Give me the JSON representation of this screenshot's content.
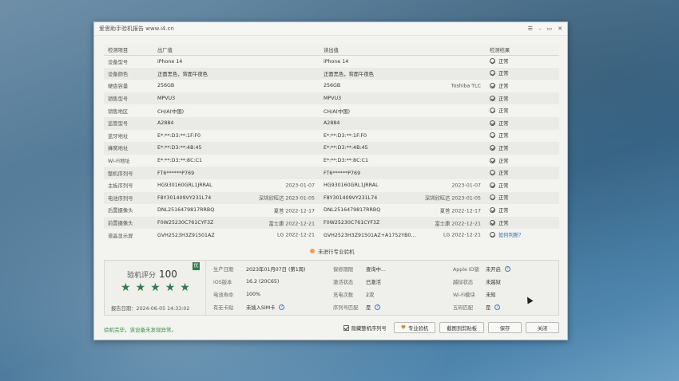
{
  "window": {
    "title": "爱思助手验机报告 www.i4.cn",
    "controls": [
      "☰",
      "–",
      "▭",
      "✕"
    ]
  },
  "table": {
    "headers": [
      "检测项目",
      "出厂值",
      "读出值",
      "检测结果"
    ],
    "rows": [
      {
        "item": "设备型号",
        "factory": "iPhone 14",
        "factory_right": "",
        "read": "iPhone 14",
        "read_right": "",
        "result": "正常",
        "link": false
      },
      {
        "item": "设备颜色",
        "factory": "正面黑色，背面午夜色",
        "factory_right": "",
        "read": "正面黑色，背面午夜色",
        "read_right": "",
        "result": "正常",
        "link": false
      },
      {
        "item": "硬盘容量",
        "factory": "256GB",
        "factory_right": "",
        "read": "256GB",
        "read_right": "Toshiba TLC",
        "result": "正常",
        "link": false
      },
      {
        "item": "销售型号",
        "factory": "MPVU3",
        "factory_right": "",
        "read": "MPVU3",
        "read_right": "",
        "result": "正常",
        "link": false
      },
      {
        "item": "销售地区",
        "factory": "CH/A(中国)",
        "factory_right": "",
        "read": "CH/A(中国)",
        "read_right": "",
        "result": "正常",
        "link": false
      },
      {
        "item": "监管型号",
        "factory": "A2884",
        "factory_right": "",
        "read": "A2884",
        "read_right": "",
        "result": "正常",
        "link": false
      },
      {
        "item": "蓝牙地址",
        "factory": "E*:**:D3:**:1F:F0",
        "factory_right": "",
        "read": "E*:**:D3:**:1F:F0",
        "read_right": "",
        "result": "正常",
        "link": false
      },
      {
        "item": "蜂窝地址",
        "factory": "E*:**:D3:**:4B:45",
        "factory_right": "",
        "read": "E*:**:D3:**:4B:45",
        "read_right": "",
        "result": "正常",
        "link": false
      },
      {
        "item": "Wi-Fi地址",
        "factory": "E*:**:D3:**:8C:C1",
        "factory_right": "",
        "read": "E*:**:D3:**:8C:C1",
        "read_right": "",
        "result": "正常",
        "link": false
      },
      {
        "item": "整机序列号",
        "factory": "FT6******P769",
        "factory_right": "",
        "read": "FT6******P769",
        "read_right": "",
        "result": "正常",
        "link": false
      },
      {
        "item": "主板序列号",
        "factory": "HG930160GRL1JRRAL",
        "factory_right": "2023-01-07",
        "read": "HG930160GRL1JRRAL",
        "read_right": "2023-01-07",
        "result": "正常",
        "link": false
      },
      {
        "item": "电池序列号",
        "factory": "F8Y301409VY231L74",
        "factory_right": "深圳欣旺达 2023-01-05",
        "read": "F8Y301409VY231L74",
        "read_right": "深圳欣旺达 2023-01-05",
        "result": "正常",
        "link": false
      },
      {
        "item": "后置摄像头",
        "factory": "DNL2516479817RRBQ",
        "factory_right": "夏普 2022-12-17",
        "read": "DNL2516479817RRBQ",
        "read_right": "夏普 2022-12-17",
        "result": "正常",
        "link": false
      },
      {
        "item": "前置摄像头",
        "factory": "F0W25230C761CYF3Z",
        "factory_right": "富士康 2022-12-21",
        "read": "F0W25230C761CYF3Z",
        "read_right": "富士康 2022-12-21",
        "result": "正常",
        "link": false
      },
      {
        "item": "液晶显示屏",
        "factory": "GVH2523H3Z91501AZ",
        "factory_right": "LG 2022-12-21",
        "read": "GVH2523H3Z91501AZ+A1752YB0...",
        "read_right": "LG 2022-12-21",
        "result": "如何判断？",
        "link": true
      }
    ]
  },
  "not_pro_label": "未进行专业验机",
  "score": {
    "label": "验机评分",
    "value": "100",
    "badge": "优",
    "stars": [
      "★",
      "★",
      "★",
      "★",
      "★"
    ],
    "report_time_label": "报告日期：",
    "report_time": "2024-06-05 14:33:02"
  },
  "info": [
    {
      "k": "生产日期",
      "v": "2023年01月07日 (第1周)",
      "q": false
    },
    {
      "k": "保修期限",
      "v": "查询中...",
      "q": false
    },
    {
      "k": "Apple ID锁",
      "v": "未开启",
      "q": true
    },
    {
      "k": "iOS版本",
      "v": "16.2 (20C65)",
      "q": false
    },
    {
      "k": "激活状态",
      "v": "已激活",
      "q": false
    },
    {
      "k": "越狱状态",
      "v": "未越狱",
      "q": false
    },
    {
      "k": "电池寿命",
      "v": "100%",
      "q": false
    },
    {
      "k": "充电次数",
      "v": "2次",
      "q": false
    },
    {
      "k": "Wi-Fi模块",
      "v": "未知",
      "q": false
    },
    {
      "k": "有无卡贴",
      "v": "未插入SIM卡",
      "q": true
    },
    {
      "k": "序列号匹配",
      "v": "是",
      "q": true
    },
    {
      "k": "五码匹配",
      "v": "是",
      "q": true
    }
  ],
  "footer": {
    "message": "验机完毕，该设备未发现异常。",
    "hide_serial_label": "隐藏整机序列号",
    "pro_button": "专业验机",
    "screenshot_button": "截图到剪贴板",
    "save_button": "保存",
    "close_button": "关闭"
  },
  "colors": {
    "accent_green": "#2f7d4a",
    "link_blue": "#3a6fb0",
    "desktop_blue": "#4f7896"
  }
}
